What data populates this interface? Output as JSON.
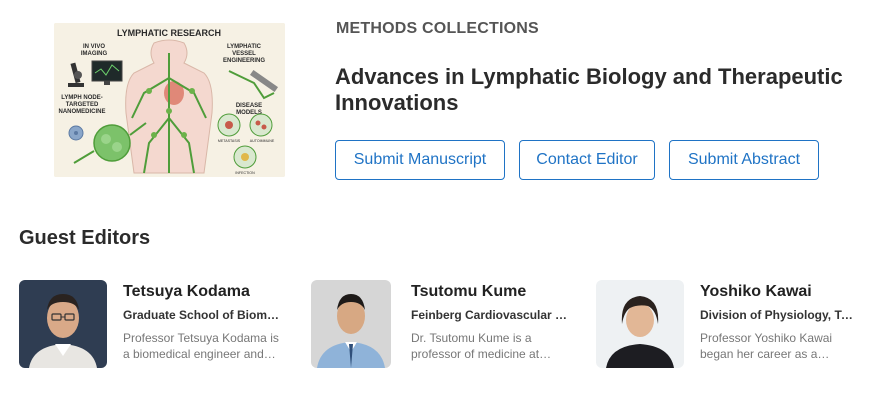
{
  "collection": {
    "eyebrow": "METHODS COLLECTIONS",
    "title": "Advances in Lymphatic Biology and Therapeutic Innovations"
  },
  "hero_image": {
    "heading": "LYMPHATIC RESEARCH",
    "labels": {
      "in_vivo_1": "IN VIVO",
      "in_vivo_2": "IMAGING",
      "vessel_1": "LYMPHATIC",
      "vessel_2": "VESSEL",
      "vessel_3": "ENGINEERING",
      "node_1": "LYMPH NODE-",
      "node_2": "TARGETED",
      "node_3": "NANOMEDICINE",
      "disease_1": "DISEASE",
      "disease_2": "MODELS",
      "metastasis": "METASTASIS",
      "autoimmune": "AUTOIMMUNE",
      "infection": "INFECTION"
    }
  },
  "actions": {
    "submit_manuscript": "Submit Manuscript",
    "contact_editor": "Contact Editor",
    "submit_abstract": "Submit Abstract"
  },
  "guest_editors": {
    "heading": "Guest Editors",
    "items": [
      {
        "name": "Tetsuya Kodama",
        "affiliation": "Graduate School of Biomedical Engineering",
        "bio": "Professor Tetsuya Kodama is a biomedical engineer and researcher"
      },
      {
        "name": "Tsutomu Kume",
        "affiliation": "Feinberg Cardiovascular and Renal Research Institute",
        "bio": "Dr. Tsutomu Kume is a professor of medicine at Northwestern"
      },
      {
        "name": "Yoshiko Kawai",
        "affiliation": "Division of Physiology, Tohoku Medical and Pharmaceutical University",
        "bio": "Professor Yoshiko Kawai began her career as a researcher"
      }
    ]
  },
  "colors": {
    "accent": "#1f73c5",
    "text": "#222222",
    "muted": "#777777"
  }
}
